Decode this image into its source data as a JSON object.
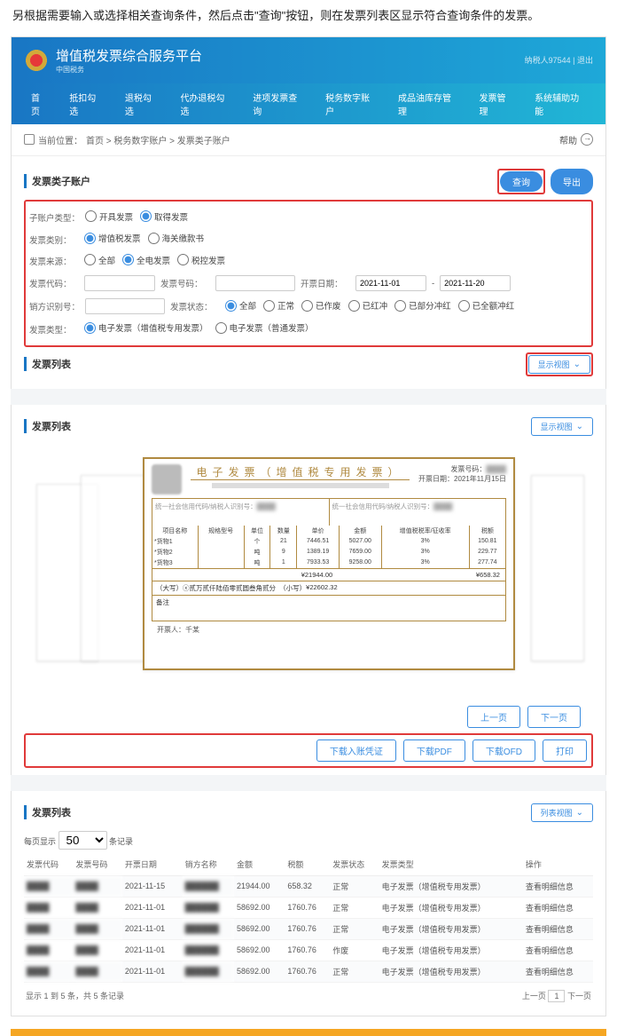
{
  "intro": "另根据需要输入或选择相关查询条件，然后点击\"查询\"按钮，则在发票列表区显示符合查询条件的发票。",
  "header": {
    "title": "增值税发票综合服务平台",
    "org": "中国税务",
    "user": "纳税人97544",
    "logout": "退出"
  },
  "nav": [
    "首页",
    "抵扣勾选",
    "退税勾选",
    "代办退税勾选",
    "进项发票查询",
    "税务数字账户",
    "成品油库存管理",
    "发票管理",
    "系统辅助功能"
  ],
  "crumb": {
    "label": "当前位置：",
    "path": "首页 > 税务数字账户 > 发票类子账户"
  },
  "help": "帮助",
  "form": {
    "title": "发票类子账户",
    "query": "查询",
    "export": "导出",
    "rows": {
      "sub_type": {
        "label": "子账户类型：",
        "opts": [
          "开具发票",
          "取得发票"
        ],
        "sel": 1
      },
      "fp_class": {
        "label": "发票类别：",
        "opts": [
          "增值税发票",
          "海关缴款书"
        ],
        "sel": 0
      },
      "source": {
        "label": "发票来源：",
        "opts": [
          "全部",
          "全电发票",
          "税控发票"
        ],
        "sel": 1
      },
      "code": {
        "label": "发票代码："
      },
      "num": {
        "label": "发票号码："
      },
      "date": {
        "label": "开票日期：",
        "from": "2021-11-01",
        "to": "2021-11-20"
      },
      "seller_id": {
        "label": "销方识别号："
      },
      "status": {
        "label": "发票状态：",
        "opts": [
          "全部",
          "正常",
          "已作废",
          "已红冲",
          "已部分冲红",
          "已全额冲红"
        ],
        "sel": 0
      },
      "fp_type": {
        "label": "发票类型：",
        "opts": [
          "电子发票（增值税专用发票）",
          "电子发票（普通发票）"
        ],
        "sel": 0
      }
    }
  },
  "list_title": "发票列表",
  "view_btn": "显示视图",
  "list_view_btn": "列表视图",
  "invoice": {
    "title": "电子发票（增值税专用发票）",
    "num_label": "发票号码：",
    "date_label": "开票日期：",
    "date": "2021年11月15日",
    "buyer_label": "统一社会信用代码/纳税人识别号：",
    "seller_label": "统一社会信用代码/纳税人识别号：",
    "cols": [
      "项目名称",
      "规格型号",
      "单位",
      "数量",
      "单价",
      "金额",
      "增值税税率/征收率",
      "税额"
    ],
    "items": [
      {
        "name": "*货物1",
        "spec": "",
        "unit": "个",
        "qty": "21",
        "price": "7446.51",
        "amt": "5027.00",
        "rate": "3%",
        "tax": "150.81"
      },
      {
        "name": "*货物2",
        "spec": "",
        "unit": "吨",
        "qty": "9",
        "price": "1389.19",
        "amt": "7659.00",
        "rate": "3%",
        "tax": "229.77"
      },
      {
        "name": "*货物3",
        "spec": "",
        "unit": "吨",
        "qty": "1",
        "price": "7933.53",
        "amt": "9258.00",
        "rate": "3%",
        "tax": "277.74"
      }
    ],
    "total_amt": "¥21944.00",
    "total_tax": "¥658.32",
    "cn_label": "（大写）",
    "cn": "ⓧ贰万贰仟陆佰零贰圆叁角贰分",
    "low_label": "（小写）",
    "low": "¥22602.32",
    "remark": "备注",
    "drawer_l": "开票人：",
    "drawer": "千某"
  },
  "prev": "上一页",
  "next": "下一页",
  "actions": [
    "下载入账凭证",
    "下载PDF",
    "下载OFD",
    "打印"
  ],
  "table": {
    "per_label": "每页显示",
    "per": "50",
    "unit": "条记录",
    "cols": [
      "发票代码",
      "发票号码",
      "开票日期",
      "销方名称",
      "金额",
      "税额",
      "发票状态",
      "发票类型",
      "操作"
    ],
    "rows": [
      {
        "date": "2021-11-15",
        "amt": "21944.00",
        "tax": "658.32",
        "status": "正常",
        "type": "电子发票（增值税专用发票）",
        "op": "查看明细信息"
      },
      {
        "date": "2021-11-01",
        "amt": "58692.00",
        "tax": "1760.76",
        "status": "正常",
        "type": "电子发票（增值税专用发票）",
        "op": "查看明细信息"
      },
      {
        "date": "2021-11-01",
        "amt": "58692.00",
        "tax": "1760.76",
        "status": "正常",
        "type": "电子发票（增值税专用发票）",
        "op": "查看明细信息"
      },
      {
        "date": "2021-11-01",
        "amt": "58692.00",
        "tax": "1760.76",
        "status": "作废",
        "type": "电子发票（增值税专用发票）",
        "op": "查看明细信息"
      },
      {
        "date": "2021-11-01",
        "amt": "58692.00",
        "tax": "1760.76",
        "status": "正常",
        "type": "电子发票（增值税专用发票）",
        "op": "查看明细信息"
      }
    ],
    "summary": "显示 1 到 5 条，共 5 条记录",
    "page": "1"
  }
}
